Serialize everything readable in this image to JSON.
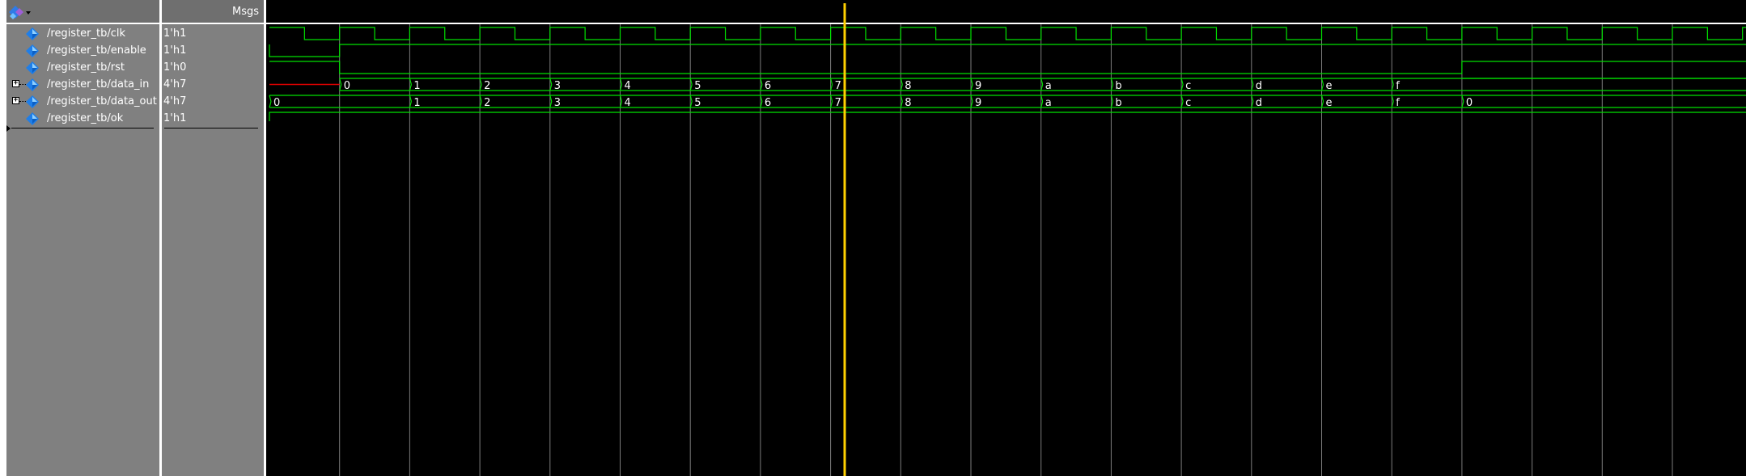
{
  "header": {
    "msgs_label": "Msgs",
    "toolbar_icon": "signal-group-icon"
  },
  "signals": [
    {
      "name": "/register_tb/clk",
      "value": "1'h1",
      "expandable": false,
      "icon": "diamond-signal-icon"
    },
    {
      "name": "/register_tb/enable",
      "value": "1'h1",
      "expandable": false,
      "icon": "diamond-signal-icon"
    },
    {
      "name": "/register_tb/rst",
      "value": "1'h0",
      "expandable": false,
      "icon": "diamond-signal-icon"
    },
    {
      "name": "/register_tb/data_in",
      "value": "4'h7",
      "expandable": true,
      "icon": "diamond-signal-icon"
    },
    {
      "name": "/register_tb/data_out",
      "value": "4'h7",
      "expandable": true,
      "icon": "diamond-signal-icon"
    },
    {
      "name": "/register_tb/ok",
      "value": "1'h1",
      "expandable": false,
      "icon": "diamond-signal-icon"
    }
  ],
  "waveform": {
    "colors": {
      "wave": "#00e000",
      "undefined": "#e00000",
      "gridline": "#7c7c7c",
      "cursor": "#ffd000",
      "background": "#000000"
    },
    "clock_cycles": 21,
    "data_in_values": [
      "0",
      "1",
      "2",
      "3",
      "4",
      "5",
      "6",
      "7",
      "8",
      "9",
      "a",
      "b",
      "c",
      "d",
      "e",
      "f"
    ],
    "data_out_values": [
      "0",
      "1",
      "2",
      "3",
      "4",
      "5",
      "6",
      "7",
      "8",
      "9",
      "a",
      "b",
      "c",
      "d",
      "e",
      "f",
      "0"
    ]
  }
}
